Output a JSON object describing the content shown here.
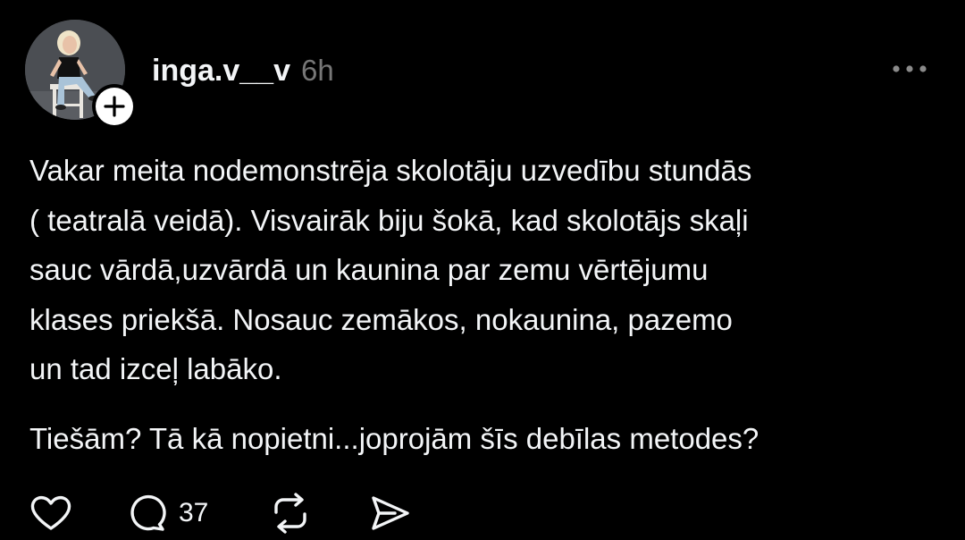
{
  "post": {
    "author": {
      "username": "inga.v__v",
      "avatar_icon": "profile-photo",
      "follow_icon": "plus-icon"
    },
    "timestamp": "6h",
    "more_icon": "more-horizontal-icon",
    "text_paragraph_1": "Vakar meita nodemonstrēja skolotāju uzvedību stundās\n( teatralā veidā). Visvairāk biju šokā, kad skolotājs skaļi\nsauc vārdā,uzvārdā un kaunina par zemu vērtējumu\nklases priekšā. Nosauc zemākos, nokaunina, pazemo\nun tad izceļ labāko.",
    "text_paragraph_2": "Tiešām? Tā kā nopietni...joprojām šīs debīlas metodes?",
    "actions": {
      "like_icon": "heart-icon",
      "reply_icon": "comment-icon",
      "reply_count": "37",
      "repost_icon": "repost-icon",
      "share_icon": "send-icon"
    }
  },
  "colors": {
    "background": "#000000",
    "text": "#f3f5f7",
    "muted": "#777777"
  }
}
